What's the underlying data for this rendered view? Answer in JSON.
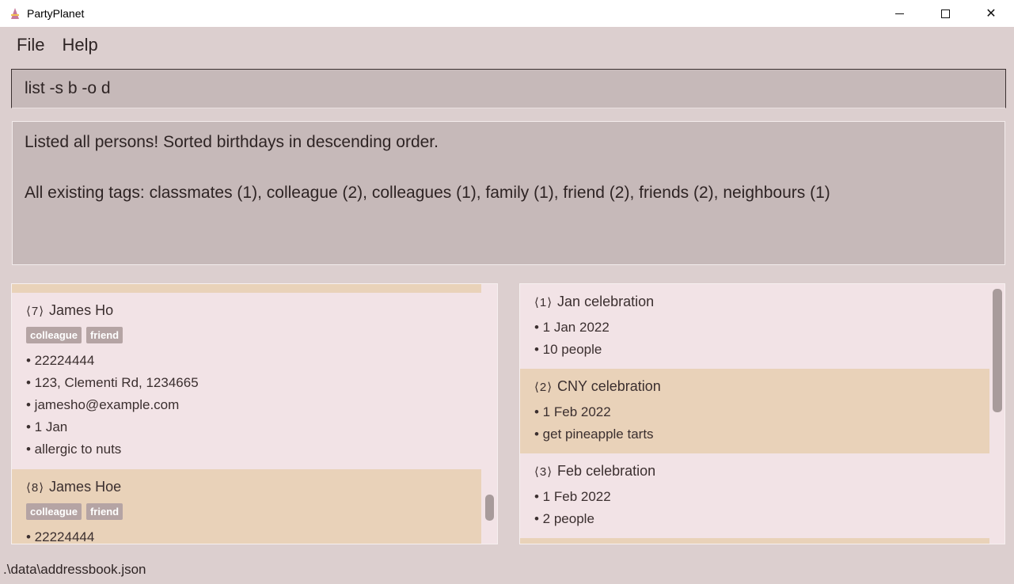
{
  "window": {
    "title": "PartyPlanet",
    "minimize": "",
    "maximize": "",
    "close": "✕"
  },
  "menu": {
    "file": "File",
    "help": "Help"
  },
  "command": {
    "value": "list -s b -o d"
  },
  "result": {
    "line1": "Listed all persons! Sorted birthdays in descending order.",
    "line2": "All existing tags: classmates (1), colleague (2), colleagues (1), family (1), friend (2), friends (2), neighbours (1)"
  },
  "persons": [
    {
      "index": "⟨7⟩",
      "name": "James Ho",
      "tags": [
        "colleague",
        "friend"
      ],
      "phone": "• 22224444",
      "address": "• 123, Clementi Rd, 1234665",
      "email": "• jamesho@example.com",
      "birthday": "• 1 Jan",
      "remark": "• allergic to nuts"
    },
    {
      "index": "⟨8⟩",
      "name": "James Hoe",
      "tags": [
        "colleague",
        "friend"
      ],
      "phone": "• 22224444"
    }
  ],
  "parties": [
    {
      "index": "⟨1⟩",
      "name": "Jan celebration",
      "date": "• 1 Jan 2022",
      "detail": "• 10 people"
    },
    {
      "index": "⟨2⟩",
      "name": "CNY celebration",
      "date": "• 1 Feb 2022",
      "detail": "• get pineapple tarts"
    },
    {
      "index": "⟨3⟩",
      "name": "Feb celebration",
      "date": "• 1 Feb 2022",
      "detail": "• 2 people"
    }
  ],
  "status": {
    "path": ".\\data\\addressbook.json"
  },
  "colors": {
    "background": "#dccfcf",
    "card_light": "#f2e3e6",
    "card_dark": "#e9d2b9",
    "tag": "#b5a4a4",
    "command_bg": "#c6b9b9"
  }
}
